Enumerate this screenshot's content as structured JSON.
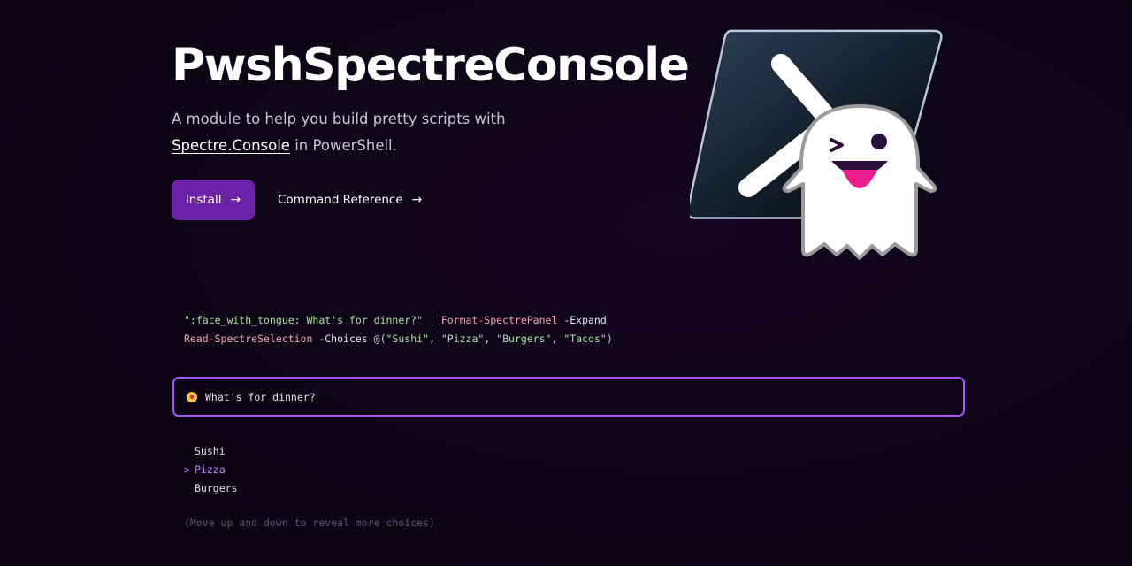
{
  "hero": {
    "title": "PwshSpectreConsole",
    "subtitle_prefix": "A module to help you build pretty scripts with",
    "subtitle_link": "Spectre.Console",
    "subtitle_suffix": " in PowerShell.",
    "install_label": "Install",
    "reference_label": "Command Reference",
    "arrow_glyph": "→"
  },
  "logo": {
    "icon": "powershell-ghost-logo-icon"
  },
  "code": {
    "line1_string": "\":face_with_tongue: What's for dinner?\"",
    "line1_pipe": " | ",
    "line1_cmd": "Format-SpectrePanel",
    "line1_param": " -Expand",
    "line2_cmd": "Read-SpectreSelection",
    "line2_param": " -Choices ",
    "line2_open": "@(",
    "line2_items": [
      "\"Sushi\"",
      "\"Pizza\"",
      "\"Burgers\"",
      "\"Tacos\""
    ],
    "line2_sep": ", ",
    "line2_close": ")"
  },
  "panel": {
    "text": "What's for dinner?",
    "emoji_icon": "face-with-tongue-icon",
    "border_color": "#a855f7"
  },
  "selection": {
    "cursor_glyph": ">",
    "choices": [
      {
        "label": "Sushi",
        "selected": false
      },
      {
        "label": "Pizza",
        "selected": true
      },
      {
        "label": "Burgers",
        "selected": false
      }
    ],
    "hint": "(Move up and down to reveal more choices)"
  },
  "colors": {
    "accent": "#6b21a8",
    "highlight": "#c084fc",
    "string": "#a6e3a1",
    "command": "#f5a3b5"
  }
}
